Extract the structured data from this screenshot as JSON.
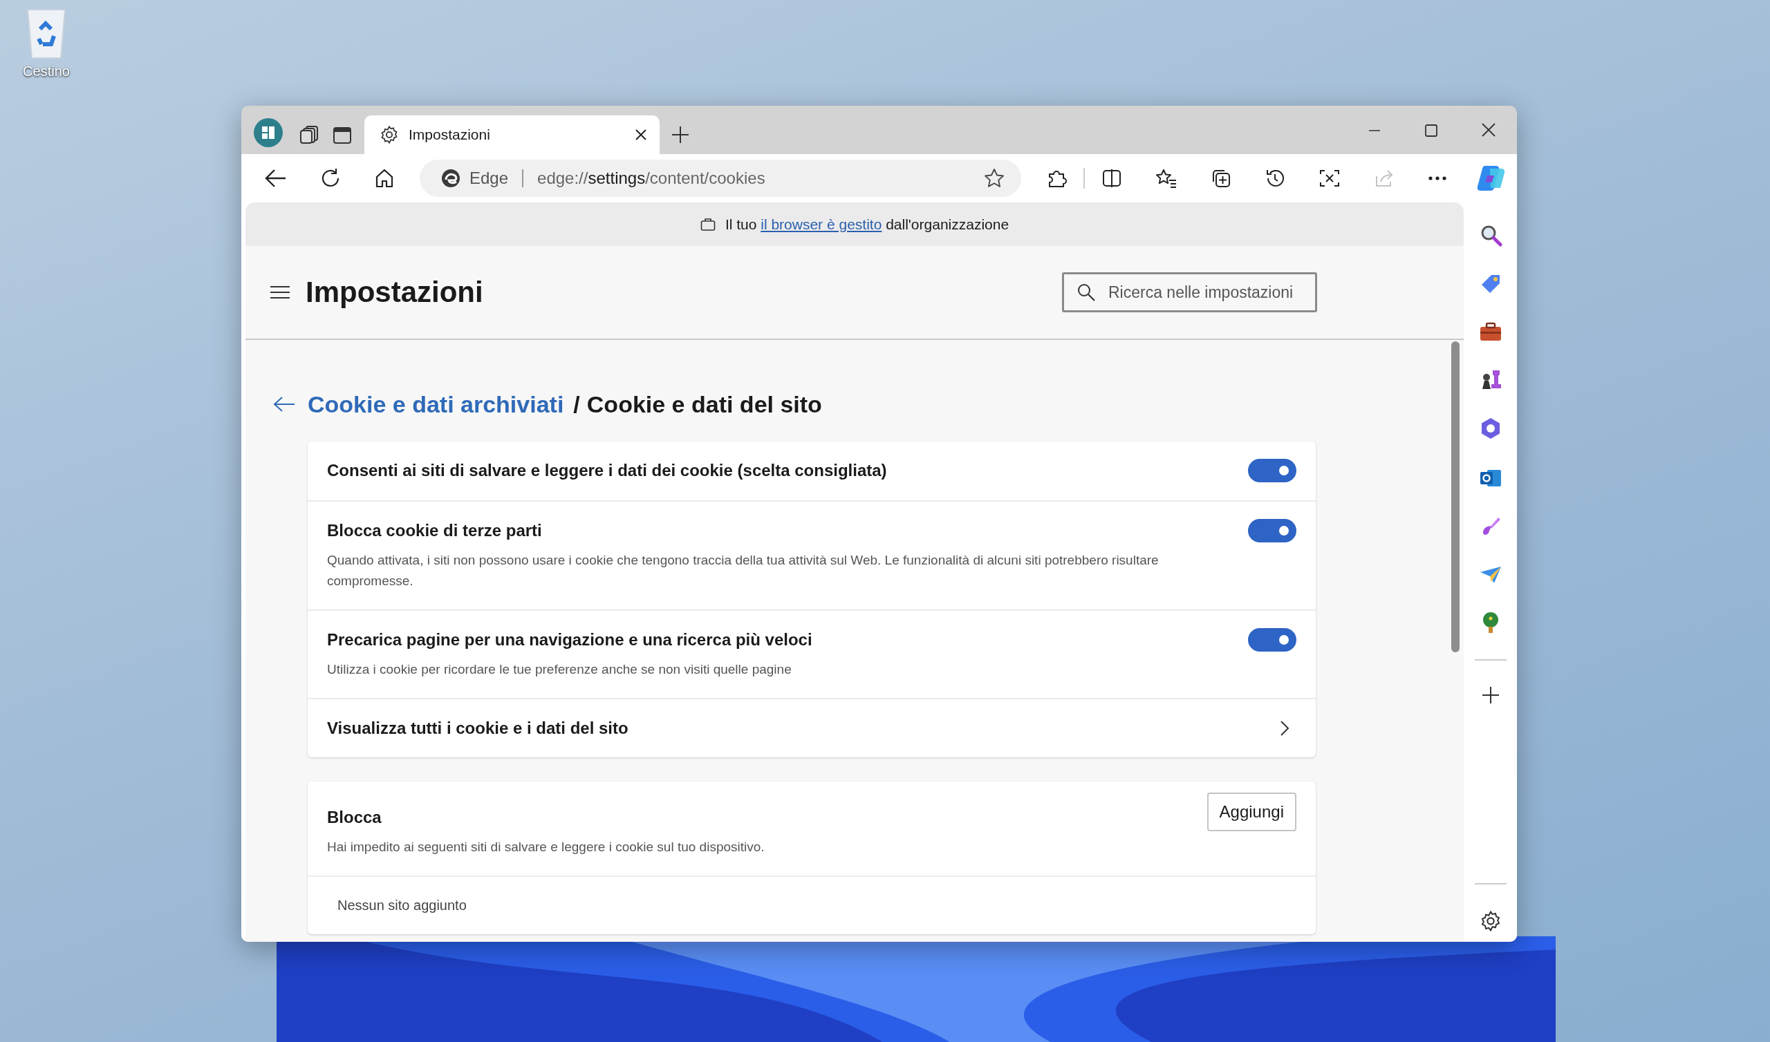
{
  "desktop": {
    "icons": [
      {
        "label": "Cestino"
      }
    ]
  },
  "window": {
    "tabs": [
      {
        "label": "Impostazioni",
        "selected": true
      }
    ],
    "address": {
      "site": "Edge",
      "url_prefix": "edge://",
      "url_main": "settings",
      "url_suffix": "/content/cookies"
    }
  },
  "banner": {
    "before": "Il tuo",
    "link": "il browser è gestito",
    "after": "dall'organizzazione"
  },
  "header": {
    "title": "Impostazioni",
    "search": {
      "placeholder": "Ricerca nelle impostazioni"
    }
  },
  "breadcrumb": {
    "parent": "Cookie e dati archiviati",
    "separator": "/",
    "current": "Cookie e dati del sito"
  },
  "settings": [
    {
      "kind": "toggle",
      "title": "Consenti ai siti di salvare e leggere i dati dei cookie (scelta consigliata)",
      "on": true
    },
    {
      "kind": "toggle",
      "title": "Blocca cookie di terze parti",
      "description": "Quando attivata, i siti non possono usare i cookie che tengono traccia della tua attività sul Web. Le funzionalità di alcuni siti potrebbero risultare compromesse.",
      "on": true
    },
    {
      "kind": "toggle",
      "title": "Precarica pagine per una navigazione e una ricerca più veloci",
      "description": "Utilizza i cookie per ricordare le tue preferenze anche se non visiti quelle pagine",
      "on": true
    },
    {
      "kind": "link",
      "title": "Visualizza tutti i cookie e i dati del sito"
    }
  ],
  "block_section": {
    "title": "Blocca",
    "description": "Hai impedito ai seguenti siti di salvare e leggere i cookie sul tuo dispositivo.",
    "button": "Aggiungi",
    "empty": "Nessun sito aggiunto"
  }
}
